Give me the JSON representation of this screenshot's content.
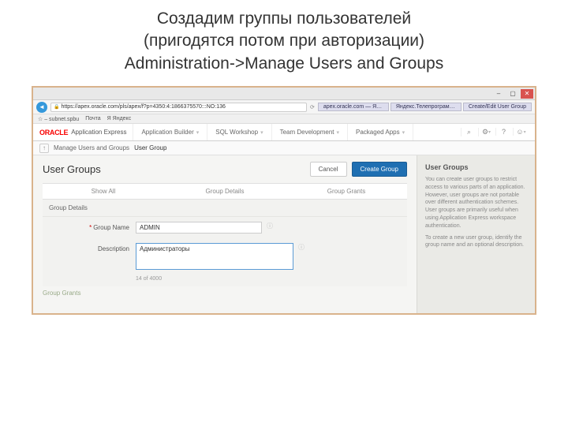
{
  "slide": {
    "line1": "Создадим группы пользователей",
    "line2": "(пригодятся потом при авторизации)",
    "line3": "Administration->Manage Users and Groups"
  },
  "browser": {
    "url": "https://apex.oracle.com/pls/apex/f?p=4350:4:1866375570:::NO:136",
    "tabs": [
      "apex.oracle.com — Яндекс: на...",
      "Яндекс.Телепрограмма в Сан...",
      "Create/Edit User Group"
    ],
    "bookmarks": [
      "☆ – subnet.spbu",
      "Почта",
      "Я Яндекс"
    ]
  },
  "oracle": {
    "logo": "ORACLE",
    "product": "Application Express",
    "tabs": [
      "Application Builder",
      "SQL Workshop",
      "Team Development",
      "Packaged Apps"
    ]
  },
  "crumb": {
    "parent": "Manage Users and Groups",
    "current": "User Group"
  },
  "page": {
    "title": "User Groups",
    "cancel": "Cancel",
    "create": "Create Group",
    "region_tabs": [
      "Show All",
      "Group Details",
      "Group Grants"
    ],
    "section_details": "Group Details",
    "section_grants": "Group Grants",
    "group_name_label": "Group Name",
    "group_name_value": "ADMIN",
    "description_label": "Description",
    "description_value": "Администраторы",
    "char_count": "14 of 4000"
  },
  "sidebar": {
    "title": "User Groups",
    "p1": "You can create user groups to restrict access to various parts of an application. However, user groups are not portable over different authentication schemes. User groups are primarily useful when using Application Express workspace authentication.",
    "p2": "To create a new user group, identify the group name and an optional description."
  }
}
